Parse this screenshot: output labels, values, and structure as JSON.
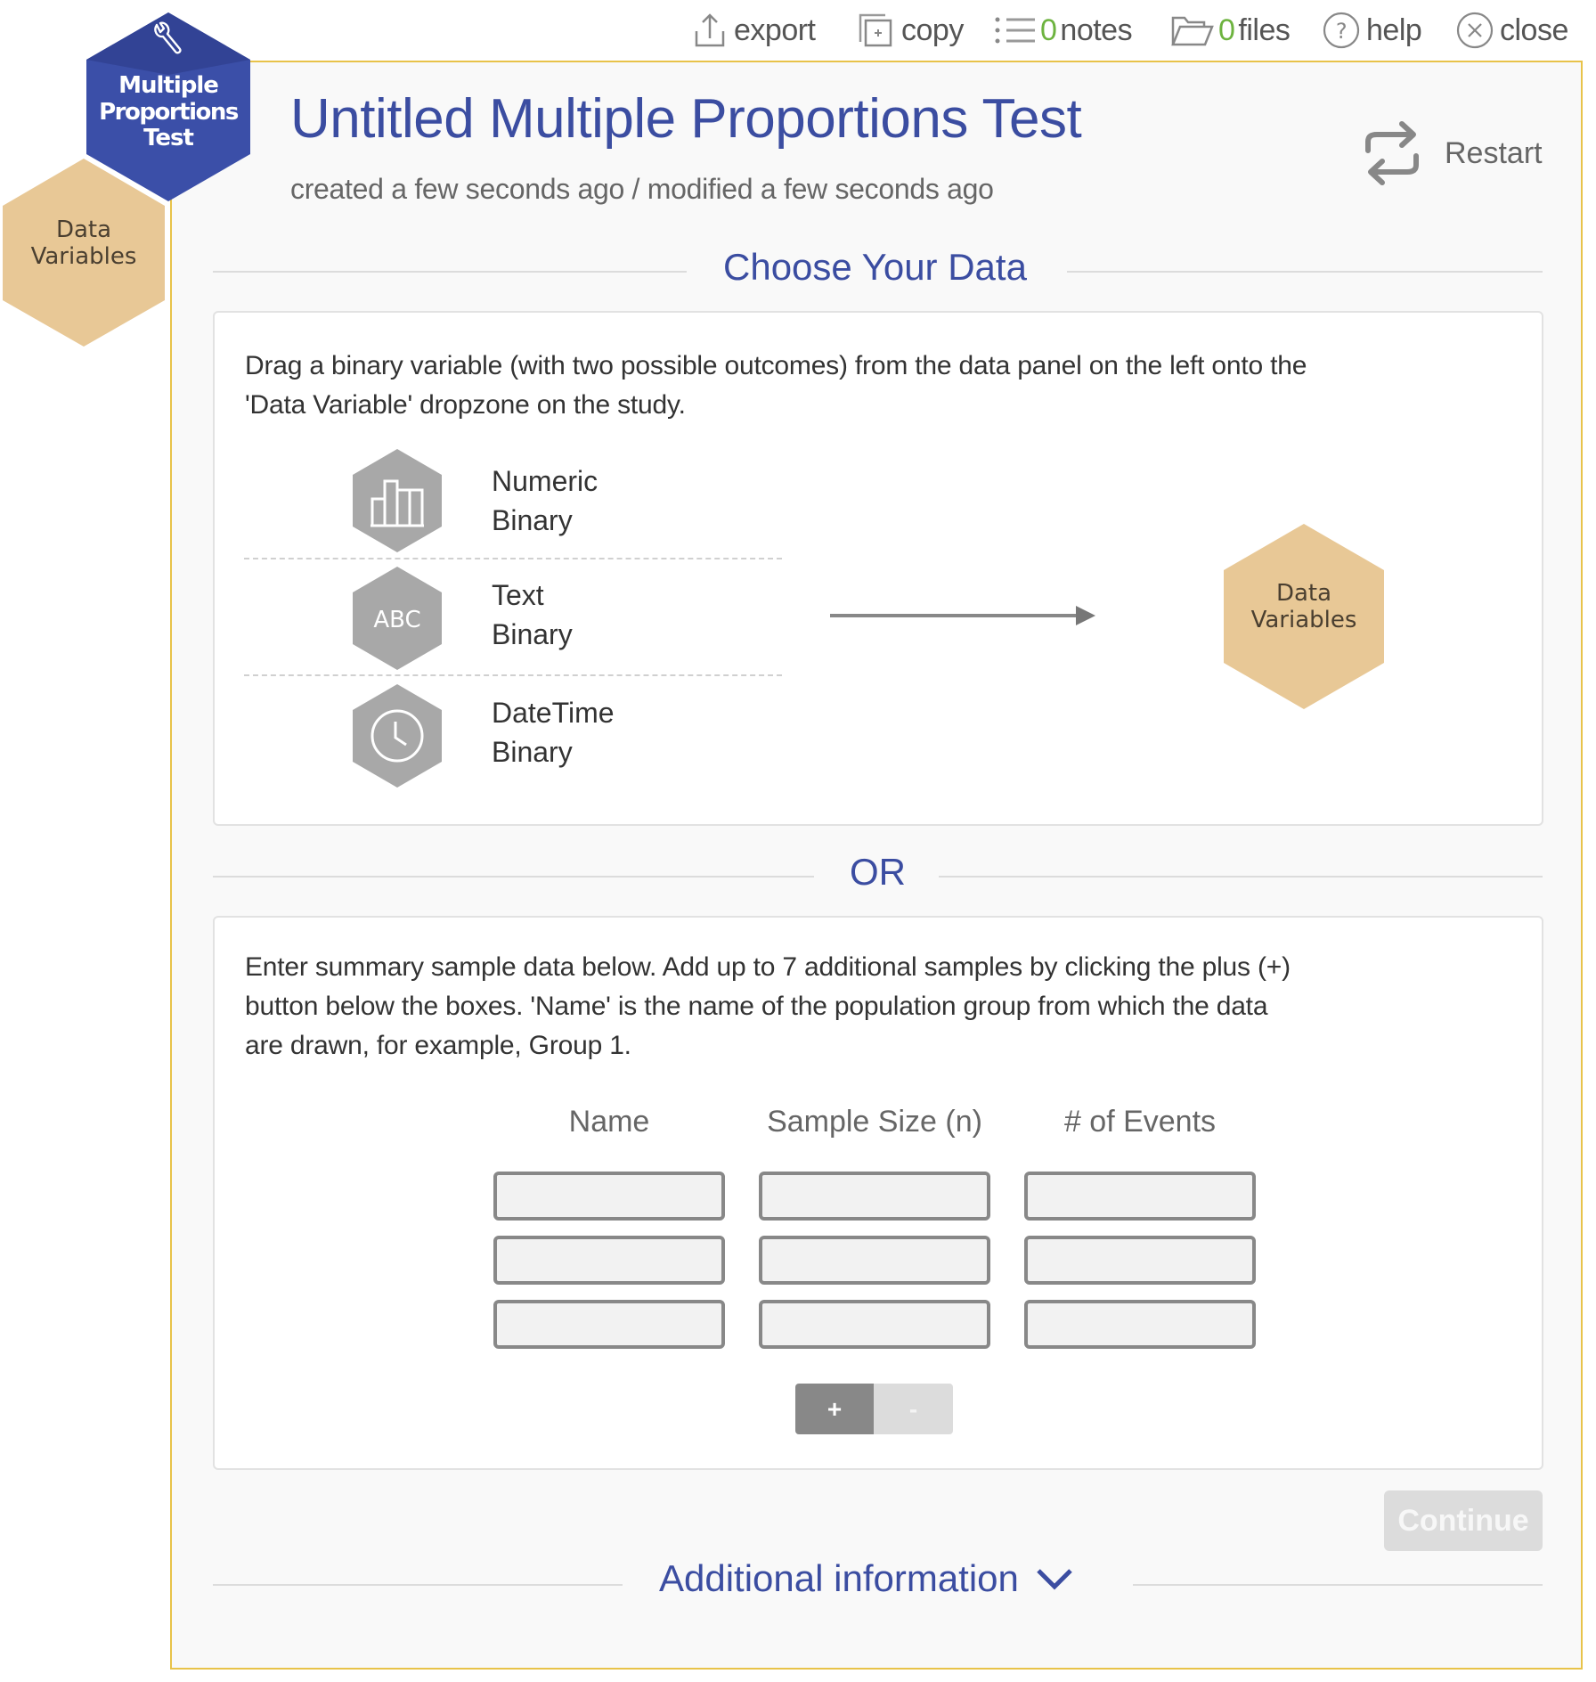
{
  "topbar": {
    "export_label": "export",
    "copy_label": "copy",
    "notes_count": "0",
    "notes_label": "notes",
    "files_count": "0",
    "files_label": "files",
    "help_label": "help",
    "close_label": "close",
    "count_color": "#6db33f"
  },
  "study_hex": {
    "line1": "Multiple",
    "line2": "Proportions",
    "line3": "Test",
    "icon": "wrench-icon",
    "color": "#3b4fa8"
  },
  "data_hex": {
    "line1": "Data",
    "line2": "Variables",
    "color": "#e8c896"
  },
  "header": {
    "title": "Untitled Multiple Proportions Test",
    "subtitle": "created a few seconds ago / modified a few seconds ago",
    "restart_label": "Restart"
  },
  "choose_data": {
    "section_title": "Choose Your Data",
    "instructions_line1": "Drag a binary variable (with two possible outcomes) from the data panel on the left onto the",
    "instructions_line2": "'Data Variable' dropzone on the study.",
    "variable_types": [
      {
        "type": "Numeric",
        "sub": "Binary",
        "icon": "bar-chart-icon"
      },
      {
        "type": "Text",
        "sub": "Binary",
        "icon": "abc-text-icon",
        "icon_text": "ABC"
      },
      {
        "type": "DateTime",
        "sub": "Binary",
        "icon": "clock-icon"
      }
    ],
    "dropzone": {
      "line1": "Data",
      "line2": "Variables"
    }
  },
  "or_label": "OR",
  "summary": {
    "instructions_line1": "Enter summary sample data below. Add up to 7 additional samples by clicking the plus (+)",
    "instructions_line2": "button below the boxes. 'Name' is the name of the population group from which the data",
    "instructions_line3": "are drawn, for example, Group 1.",
    "columns": [
      "Name",
      "Sample Size (n)",
      "# of Events"
    ],
    "rows": [
      {
        "name": "",
        "sample_size": "",
        "events": ""
      },
      {
        "name": "",
        "sample_size": "",
        "events": ""
      },
      {
        "name": "",
        "sample_size": "",
        "events": ""
      }
    ],
    "add_label": "+",
    "remove_label": "-"
  },
  "continue_label": "Continue",
  "additional_info_label": "Additional information"
}
